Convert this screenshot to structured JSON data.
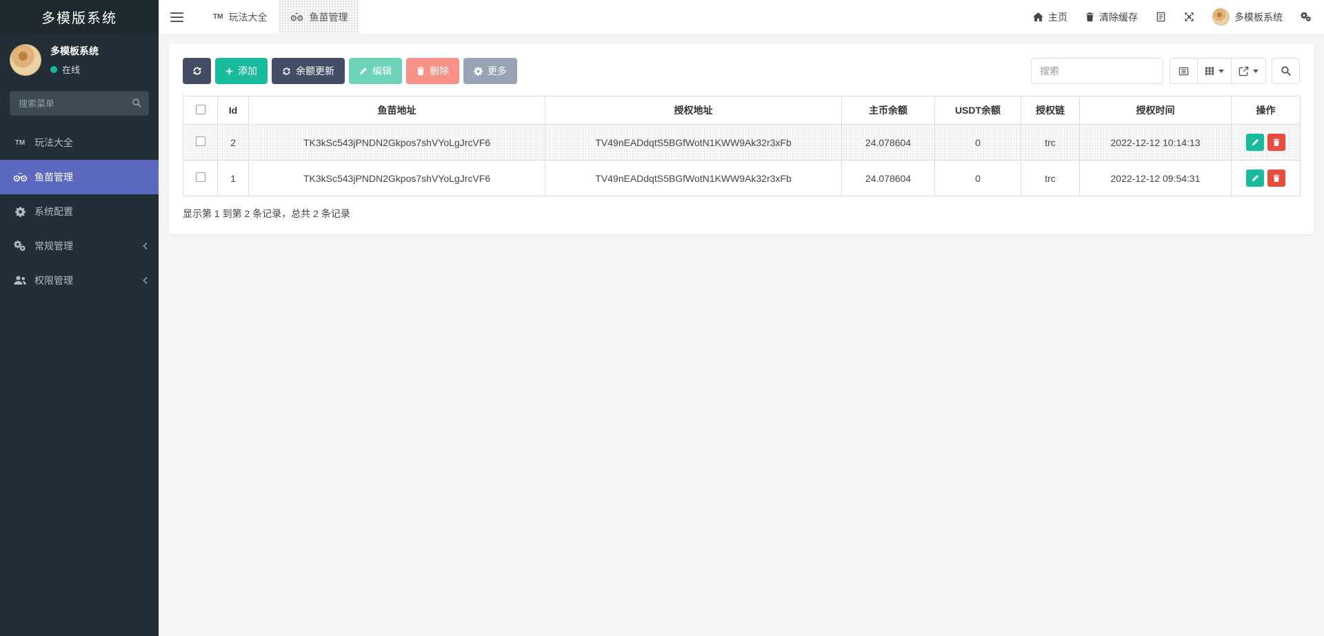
{
  "brand": {
    "title": "多模版系统"
  },
  "sidebar": {
    "user": {
      "name": "多模板系统",
      "status": "在线"
    },
    "search_placeholder": "搜索菜单",
    "tm_badge": "TM",
    "items": [
      {
        "label": "玩法大全"
      },
      {
        "label": "鱼苗管理"
      },
      {
        "label": "系统配置"
      },
      {
        "label": "常规管理"
      },
      {
        "label": "权限管理"
      }
    ]
  },
  "navbar": {
    "tabs": [
      {
        "label": "玩法大全"
      },
      {
        "label": "鱼苗管理"
      }
    ],
    "home_label": "主页",
    "clear_cache_label": "清除缓存",
    "user_label": "多模板系统"
  },
  "toolbar": {
    "add_label": "添加",
    "balance_update_label": "余额更新",
    "edit_label": "编辑",
    "delete_label": "删除",
    "more_label": "更多",
    "search_placeholder": "搜索"
  },
  "table": {
    "columns": [
      "Id",
      "鱼苗地址",
      "授权地址",
      "主币余额",
      "USDT余额",
      "授权链",
      "授权时间",
      "操作"
    ],
    "rows": [
      {
        "id": "2",
        "fry_address": "TK3kSc543jPNDN2Gkpos7shVYoLgJrcVF6",
        "auth_address": "TV49nEADdqtS5BGfWotN1KWW9Ak32r3xFb",
        "main_balance": "24.078604",
        "usdt_balance": "0",
        "chain": "trc",
        "auth_time": "2022-12-12 10:14:13"
      },
      {
        "id": "1",
        "fry_address": "TK3kSc543jPNDN2Gkpos7shVYoLgJrcVF6",
        "auth_address": "TV49nEADdqtS5BGfWotN1KWW9Ak32r3xFb",
        "main_balance": "24.078604",
        "usdt_balance": "0",
        "chain": "trc",
        "auth_time": "2022-12-12 09:54:31"
      }
    ],
    "summary": "显示第 1 到第 2 条记录，总共 2 条记录"
  },
  "colors": {
    "accent_green": "#18bc9c",
    "active_menu_blue": "#5a68c0",
    "dark_button": "#454d66",
    "delete_red": "#e74c3c",
    "sidebar_bg": "#222d35"
  }
}
